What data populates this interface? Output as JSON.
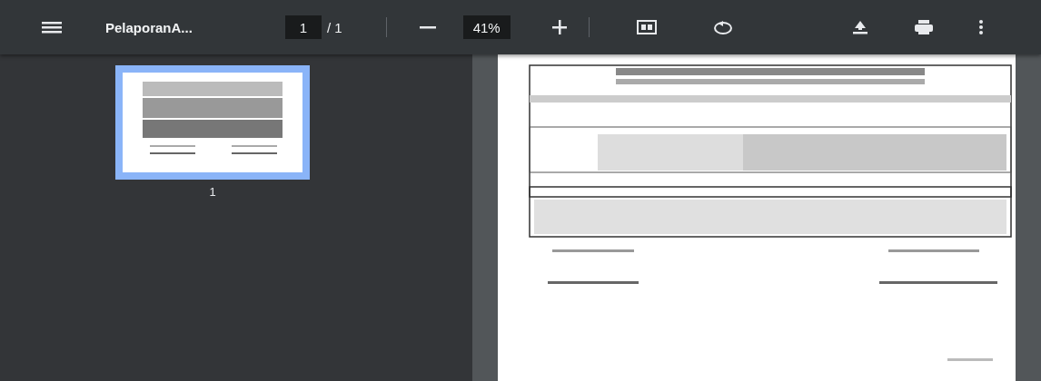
{
  "toolbar": {
    "title": "PelaporanA...",
    "page_input": "1",
    "page_total": "/ 1",
    "zoom": "41%"
  },
  "thumbnails": [
    {
      "label": "1",
      "selected": true
    }
  ]
}
